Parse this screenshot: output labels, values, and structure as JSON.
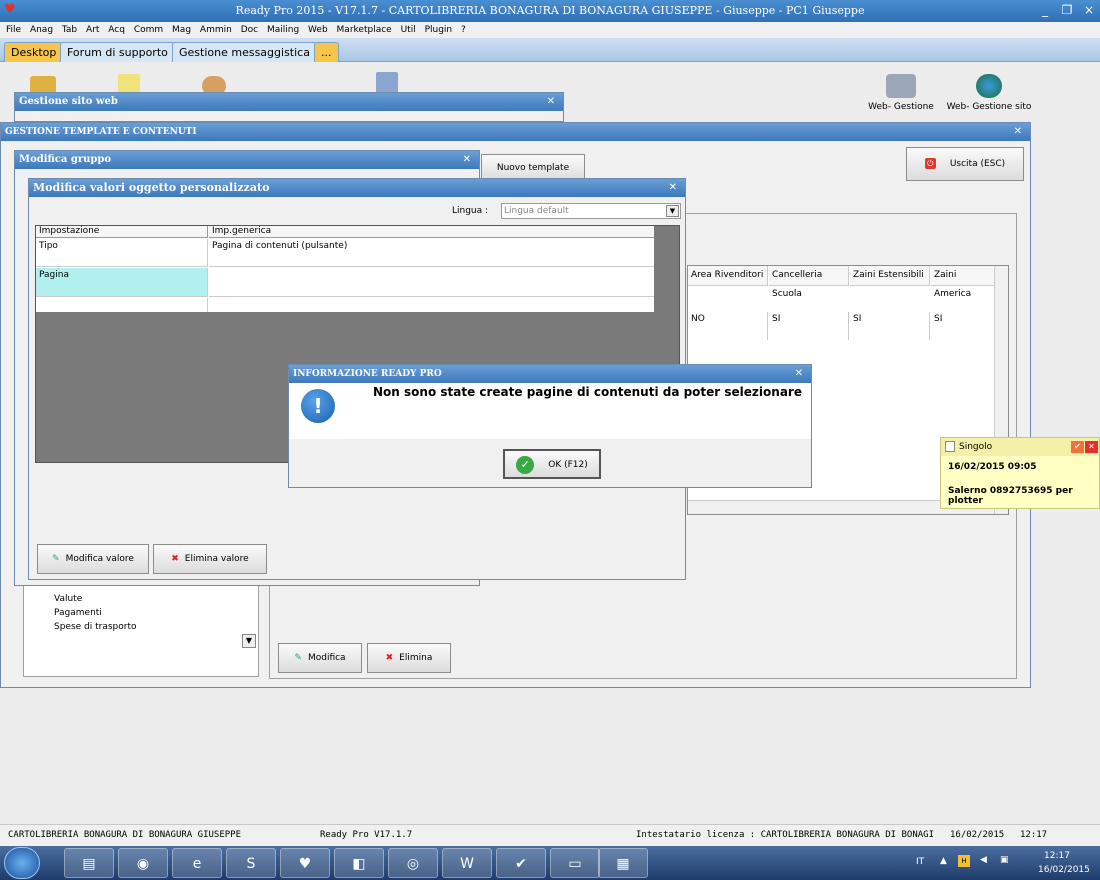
{
  "app_title": "Ready Pro 2015 - V17.1.7 - CARTOLIBRERIA BONAGURA DI BONAGURA GIUSEPPE - Giuseppe - PC1 Giuseppe",
  "menu": [
    "File",
    "Anag",
    "Tab",
    "Art",
    "Acq",
    "Comm",
    "Mag",
    "Ammin",
    "Doc",
    "Mailing",
    "Web",
    "Marketplace",
    "Util",
    "Plugin",
    "?"
  ],
  "tabs": [
    "Desktop",
    "Forum di supporto",
    "Gestione messaggistica",
    "..."
  ],
  "desktop_icons": {
    "web_gestione": "Web- Gestione",
    "web_sito": "Web- Gestione sito"
  },
  "win_sito": {
    "title": "Gestione sito web"
  },
  "win_template": {
    "title": "GESTIONE TEMPLATE E CONTENUTI",
    "uscita": "Uscita (ESC)",
    "nuovo_template": "Nuovo template",
    "modifica": "Modifica",
    "elimina": "Elimina"
  },
  "tree_items": [
    "Valute",
    "Pagamenti",
    "Spese di trasporto"
  ],
  "win_gruppo": {
    "title": "Modifica gruppo"
  },
  "grid_right": {
    "headers": [
      "Area Rivenditori",
      "Cancelleria Scuola",
      "Zaini Estensibili",
      "Zaini America"
    ],
    "row1": [
      "NO",
      "SI",
      "SI",
      "SI"
    ]
  },
  "win_valori": {
    "title": "Modifica valori oggetto personalizzato",
    "lingua_label": "Lingua :",
    "lingua_value": "Lingua default",
    "col1": "Impostazione",
    "col2": "Imp.generica",
    "row1_key": "Tipo",
    "row1_val": "Pagina di contenuti (pulsante)",
    "row2_key": "Pagina",
    "modifica_valore": "Modifica valore",
    "elimina_valore": "Elimina valore"
  },
  "dialog": {
    "title": "INFORMAZIONE READY PRO",
    "message": "Non sono state create pagine di contenuti da poter selezionare",
    "ok": "OK (F12)"
  },
  "note": {
    "title": "Singolo",
    "date": "16/02/2015  09:05",
    "text": "Salerno  0892753695 per plotter"
  },
  "status": {
    "company": "CARTOLIBRERIA BONAGURA DI BONAGURA GIUSEPPE",
    "version": "Ready Pro V17.1.7",
    "license": "Intestatario licenza : CARTOLIBRERIA BONAGURA DI BONAGI",
    "date": "16/02/2015",
    "time": "12:17"
  },
  "taskbar": {
    "lang": "IT",
    "time": "12:17",
    "date": "16/02/2015"
  },
  "colors": {
    "title_blue": "#3d78bb",
    "active_tab": "#f7c54a",
    "note_yellow": "#ffffc4",
    "selected_cell": "#b2f0f0"
  }
}
